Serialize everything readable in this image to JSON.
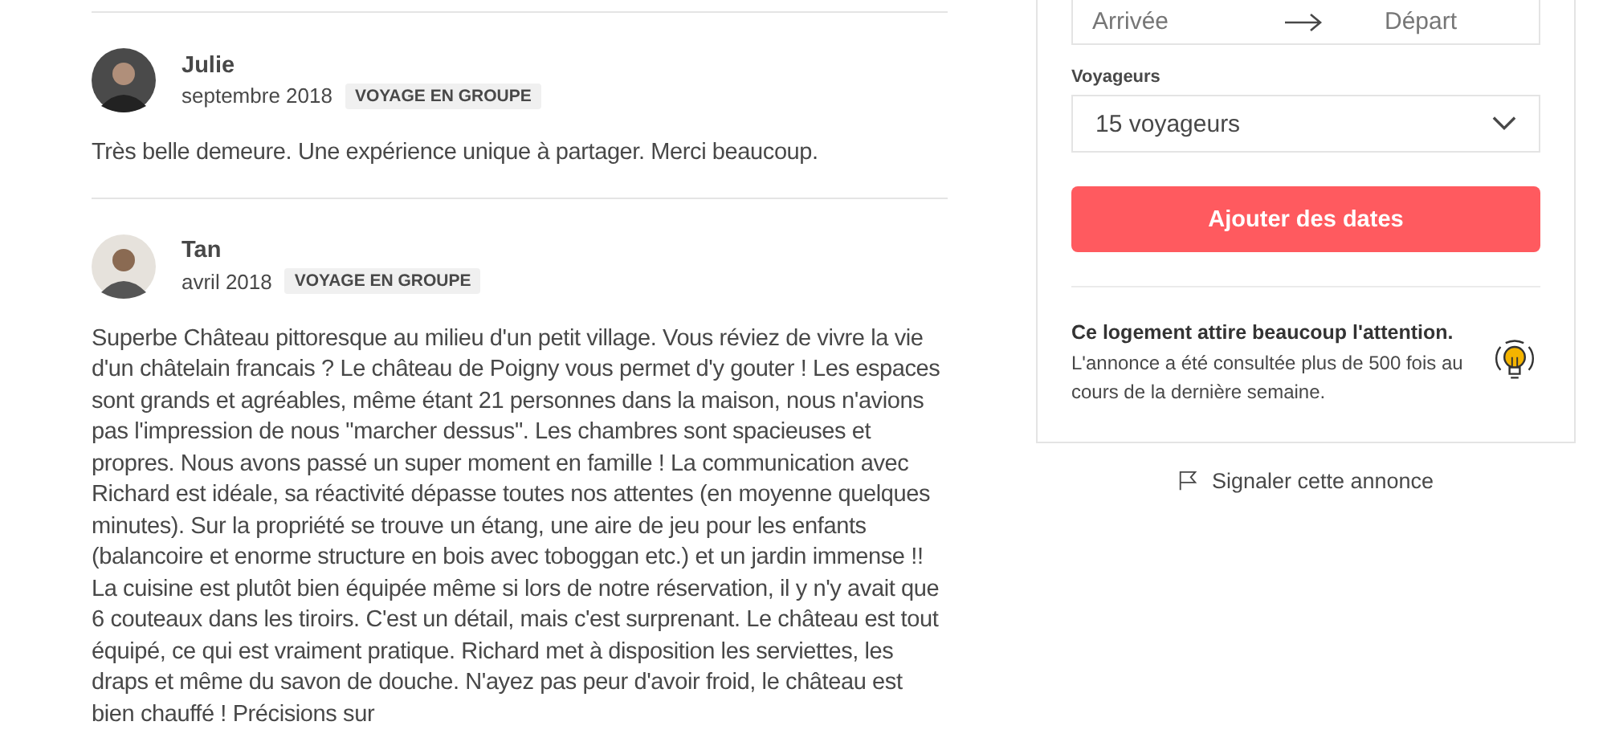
{
  "reviews": [
    {
      "name": "Julie",
      "date": "septembre 2018",
      "tag": "VOYAGE EN GROUPE",
      "text": "Très belle demeure. Une expérience unique à partager. Merci beaucoup."
    },
    {
      "name": "Tan",
      "date": "avril 2018",
      "tag": "VOYAGE EN GROUPE",
      "text": "Superbe Château pittoresque au milieu d'un petit village. Vous réviez de vivre la vie d'un châtelain francais ? Le château de Poigny vous permet d'y gouter ! Les espaces sont grands et agréables, même étant 21 personnes dans la maison, nous n'avions pas l'impression de nous \"marcher dessus\". Les chambres sont spacieuses et propres. Nous avons passé un super moment en famille ! La communication avec Richard est idéale, sa réactivité dépasse toutes nos attentes (en moyenne quelques minutes). Sur la propriété se trouve un étang, une aire de jeu pour les enfants (balancoire et enorme structure en bois avec toboggan etc.) et un jardin immense !! La cuisine est plutôt bien équipée même si lors de notre réservation, il y n'y avait que 6 couteaux dans les tiroirs. C'est un détail, mais c'est surprenant. Le château est tout équipé, ce qui est vraiment pratique. Richard met à disposition les serviettes, les draps et même du savon de douche. N'ayez pas peur d'avoir froid, le château est bien chauffé ! Précisions sur"
    }
  ],
  "booking": {
    "dates": {
      "checkin_placeholder": "Arrivée",
      "checkout_placeholder": "Départ"
    },
    "guests_label": "Voyageurs",
    "guests_value": "15 voyageurs",
    "button": "Ajouter des dates",
    "notice": {
      "title": "Ce logement attire beaucoup l'attention.",
      "text": "L'annonce a été consultée plus de 500 fois au cours de la dernière semaine."
    }
  },
  "report_link": "Signaler cette annonce"
}
